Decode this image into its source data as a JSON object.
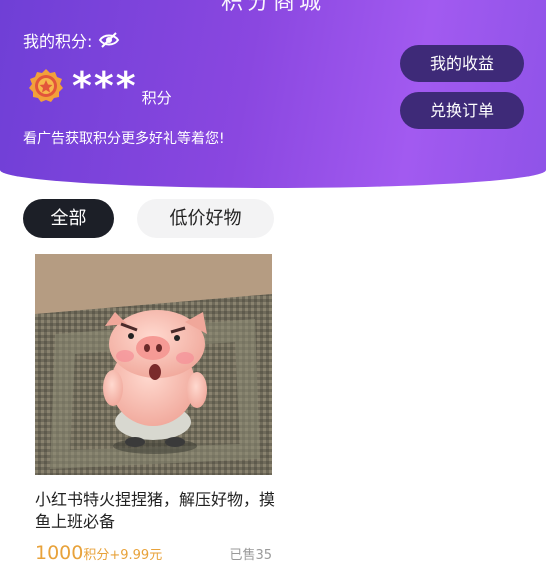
{
  "header": {
    "title": "积分商城",
    "points_label": "我的积分:",
    "points_masked": "***",
    "points_unit": "积分",
    "promo": "看广告获取积分更多好礼等着您!",
    "buttons": {
      "earnings": "我的收益",
      "orders": "兑换订单"
    }
  },
  "tabs": [
    {
      "label": "全部",
      "active": true
    },
    {
      "label": "低价好物",
      "active": false
    }
  ],
  "products": [
    {
      "title": "小红书特火捏捏猪，解压好物，摸鱼上班必备",
      "price_points": "1000",
      "price_suffix": "积分+9.99元",
      "sold": "已售35"
    }
  ],
  "icons": {
    "eye": "eye-off-icon",
    "medal": "medal-icon"
  },
  "colors": {
    "brand": "#8a47e0",
    "price": "#e8a23a",
    "button": "#3e2a78"
  }
}
